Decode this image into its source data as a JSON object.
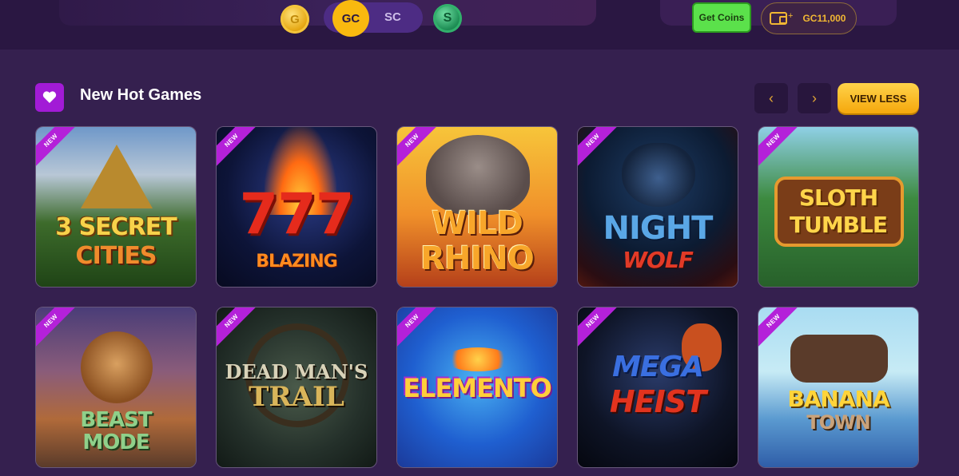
{
  "topbar": {
    "currency_gc": "GC",
    "currency_sc": "SC",
    "gold_coin_letter": "G",
    "sweep_coin_letter": "S",
    "get_coins_label": "Get Coins",
    "balance": "GC11,000",
    "wallet_plus": "+"
  },
  "section": {
    "title": "New Hot Games",
    "prev_arrow": "‹",
    "next_arrow": "›",
    "view_less_label": "VIEW LESS"
  },
  "ribbon_label": "NEW",
  "games": [
    {
      "line1": "3 SECRET",
      "line2": "CITIES"
    },
    {
      "line1": "777",
      "line2": "BLAZING"
    },
    {
      "line1": "WILD",
      "line2": "RHINO"
    },
    {
      "line1": "NIGHT",
      "line2": "WOLF"
    },
    {
      "line1": "SLOTH",
      "line2": "TUMBLE"
    },
    {
      "line1": "BEAST",
      "line2": "MODE"
    },
    {
      "line1": "DEAD MAN'S",
      "line2": "TRAIL"
    },
    {
      "line1": "ELEMENTO",
      "line2": ""
    },
    {
      "line1": "MEGA",
      "line2": "HEIST"
    },
    {
      "line1": "BANANA",
      "line2": "TOWN"
    }
  ],
  "colors": {
    "background": "#35204f",
    "accent_gold": "#f9b90f",
    "accent_purple": "#a21bd6",
    "get_coins_green": "#5be14b"
  }
}
